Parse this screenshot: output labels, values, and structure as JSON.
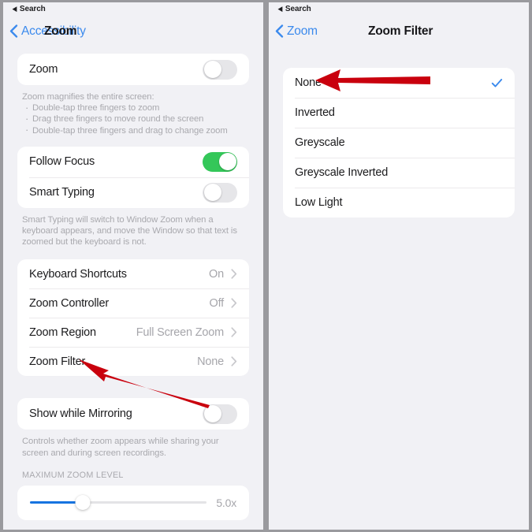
{
  "left_panel": {
    "statusbar": {
      "back_label": "Search",
      "triangle_icon": "left-triangle-icon"
    },
    "nav": {
      "back_label": "Accessibility",
      "title": "Zoom"
    },
    "zoom_card": {
      "rows": [
        {
          "label": "Zoom",
          "toggle": "off"
        }
      ]
    },
    "zoom_description": {
      "heading": "Zoom magnifies the entire screen:",
      "bullets": [
        "Double-tap three fingers to zoom",
        "Drag three fingers to move round the screen",
        "Double-tap three fingers and drag to change zoom"
      ]
    },
    "focus_card": {
      "rows": [
        {
          "label": "Follow Focus",
          "toggle": "on"
        },
        {
          "label": "Smart Typing",
          "toggle": "off"
        }
      ]
    },
    "smart_typing_description": "Smart Typing will switch to Window Zoom when a keyboard appears, and move the Window so that text is zoomed but the keyboard is not.",
    "options_card": {
      "rows": [
        {
          "label": "Keyboard Shortcuts",
          "value": "On"
        },
        {
          "label": "Zoom Controller",
          "value": "Off"
        },
        {
          "label": "Zoom Region",
          "value": "Full Screen Zoom"
        },
        {
          "label": "Zoom Filter",
          "value": "None"
        }
      ]
    },
    "mirroring_card": {
      "rows": [
        {
          "label": "Show while Mirroring",
          "toggle": "off"
        }
      ]
    },
    "mirroring_description": "Controls whether zoom appears while sharing your screen and during screen recordings.",
    "zoom_level": {
      "group_header": "MAXIMUM ZOOM LEVEL",
      "value_label": "5.0x",
      "fill_percent": 30
    }
  },
  "right_panel": {
    "statusbar": {
      "back_label": "Search",
      "triangle_icon": "left-triangle-icon"
    },
    "nav": {
      "back_label": "Zoom",
      "title": "Zoom Filter"
    },
    "filter_card": {
      "rows": [
        {
          "label": "None",
          "selected": true
        },
        {
          "label": "Inverted",
          "selected": false
        },
        {
          "label": "Greyscale",
          "selected": false
        },
        {
          "label": "Greyscale Inverted",
          "selected": false
        },
        {
          "label": "Low Light",
          "selected": false
        }
      ]
    }
  },
  "annotations": {
    "arrow_color": "#c9000d",
    "arrow_zoom_filter_row": "arrow-pointing-to-zoom-filter",
    "arrow_none_option": "arrow-pointing-to-none-option"
  },
  "colors": {
    "accent_blue": "#3b8aed",
    "toggle_on_green": "#34c759",
    "slider_blue": "#1673e0",
    "page_background": "#f1f1f5",
    "card_background": "#ffffff"
  }
}
